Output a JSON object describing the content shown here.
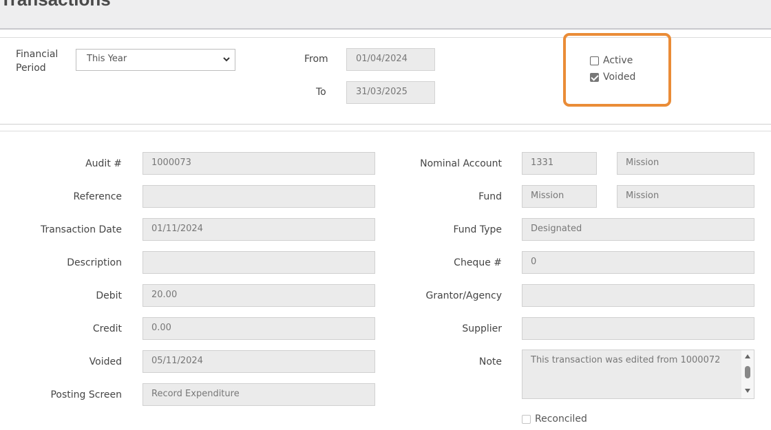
{
  "header": {
    "title": "st Transactions"
  },
  "filters": {
    "financial_period_label": "Financial Period",
    "financial_period_value": "This Year",
    "from_label": "From",
    "from_value": "01/04/2024",
    "to_label": "To",
    "to_value": "31/03/2025",
    "status": [
      {
        "label": "Active",
        "checked": false
      },
      {
        "label": "Voided",
        "checked": true
      }
    ],
    "highlight_color": "#ea8c37"
  },
  "details": {
    "left": [
      {
        "label": "Audit #",
        "value": "1000073"
      },
      {
        "label": "Reference",
        "value": ""
      },
      {
        "label": "Transaction Date",
        "value": "01/11/2024"
      },
      {
        "label": "Description",
        "value": ""
      },
      {
        "label": "Debit",
        "value": "20.00"
      },
      {
        "label": "Credit",
        "value": "0.00"
      },
      {
        "label": "Voided",
        "value": "05/11/2024"
      },
      {
        "label": "Posting Screen",
        "value": "Record Expenditure"
      }
    ],
    "right": {
      "nominal_account": {
        "label": "Nominal Account",
        "code": "1331",
        "name": "Mission"
      },
      "fund": {
        "label": "Fund",
        "code": "Mission",
        "name": "Mission"
      },
      "fund_type": {
        "label": "Fund Type",
        "value": "Designated"
      },
      "cheque": {
        "label": "Cheque #",
        "value": "0"
      },
      "grantor": {
        "label": "Grantor/Agency",
        "value": ""
      },
      "supplier": {
        "label": "Supplier",
        "value": ""
      },
      "note": {
        "label": "Note",
        "value": "This transaction was edited from 1000072"
      },
      "reconciled": {
        "label": "Reconciled",
        "checked": false
      }
    }
  }
}
